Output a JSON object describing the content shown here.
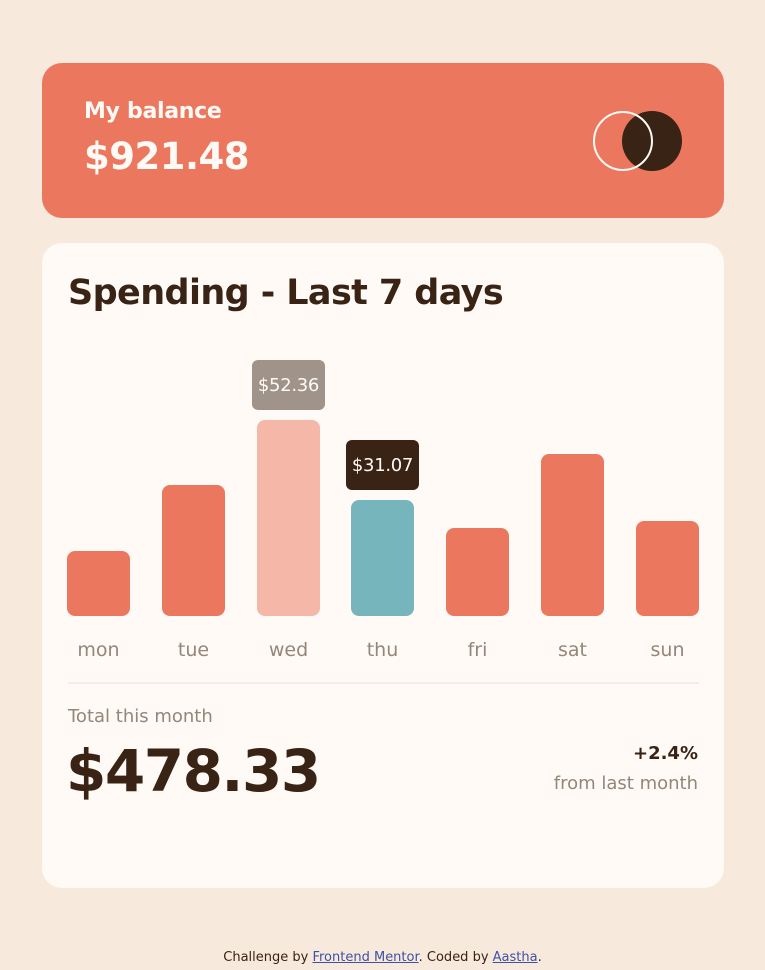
{
  "balance": {
    "label": "My balance",
    "value": "$921.48"
  },
  "spending": {
    "title": "Spending - Last 7 days",
    "total_label": "Total this month",
    "total_value": "$478.33",
    "change_value": "+2.4%",
    "change_label": "from last month"
  },
  "chart_data": {
    "type": "bar",
    "categories": [
      "mon",
      "tue",
      "wed",
      "thu",
      "fri",
      "sat",
      "sun"
    ],
    "values": [
      17.45,
      34.91,
      52.36,
      31.07,
      23.39,
      43.28,
      25.48
    ],
    "ylim": [
      0,
      52.36
    ],
    "tooltips": [
      {
        "day_index": 2,
        "text": "$52.36",
        "style": "hover"
      },
      {
        "day_index": 3,
        "text": "$31.07",
        "style": "active"
      }
    ],
    "colors": {
      "default": "#ec775f",
      "hover": "#f5b7a7",
      "active": "#76b5bc",
      "tooltip_hover": "#a0938a",
      "tooltip_active": "#382314"
    }
  },
  "footer": {
    "prefix": "Challenge by ",
    "link1": "Frontend Mentor",
    "middle": ". Coded by ",
    "link2": "Aastha",
    "suffix": "."
  }
}
